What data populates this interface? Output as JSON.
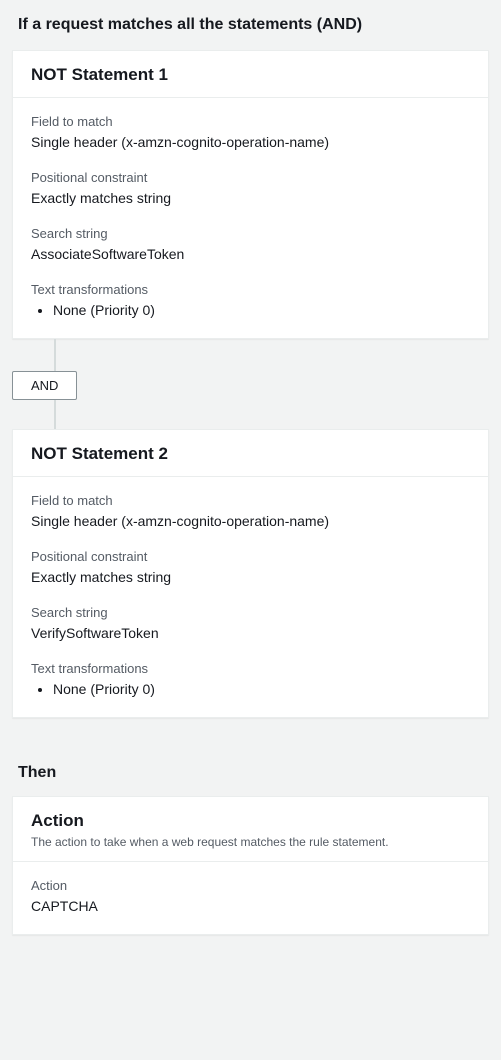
{
  "if_section": {
    "title": "If a request matches all the statements (AND)",
    "connector_label": "AND",
    "statements": [
      {
        "name": "NOT Statement 1",
        "field_to_match_label": "Field to match",
        "field_to_match_value": "Single header (x-amzn-cognito-operation-name)",
        "positional_constraint_label": "Positional constraint",
        "positional_constraint_value": "Exactly matches string",
        "search_string_label": "Search string",
        "search_string_value": "AssociateSoftwareToken",
        "text_transformations_label": "Text transformations",
        "text_transformations_items": [
          "None (Priority 0)"
        ]
      },
      {
        "name": "NOT Statement 2",
        "field_to_match_label": "Field to match",
        "field_to_match_value": "Single header (x-amzn-cognito-operation-name)",
        "positional_constraint_label": "Positional constraint",
        "positional_constraint_value": "Exactly matches string",
        "search_string_label": "Search string",
        "search_string_value": "VerifySoftwareToken",
        "text_transformations_label": "Text transformations",
        "text_transformations_items": [
          "None (Priority 0)"
        ]
      }
    ]
  },
  "then_section": {
    "title": "Then",
    "action_card": {
      "header": "Action",
      "subtext": "The action to take when a web request matches the rule statement.",
      "action_label": "Action",
      "action_value": "CAPTCHA"
    }
  }
}
